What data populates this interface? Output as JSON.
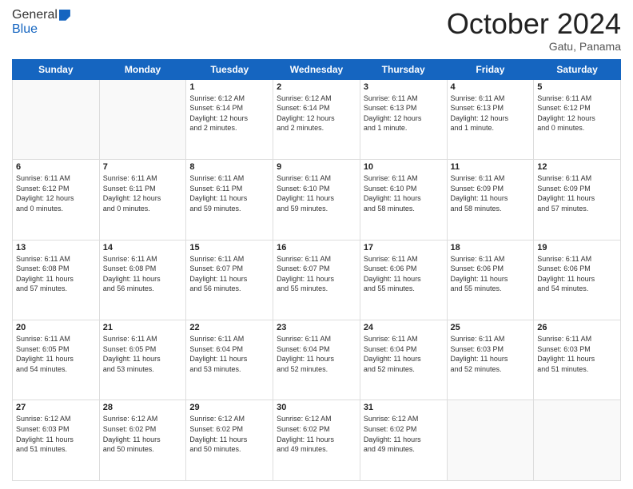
{
  "header": {
    "logo_general": "General",
    "logo_blue": "Blue",
    "month_title": "October 2024",
    "location": "Gatu, Panama"
  },
  "days_of_week": [
    "Sunday",
    "Monday",
    "Tuesday",
    "Wednesday",
    "Thursday",
    "Friday",
    "Saturday"
  ],
  "weeks": [
    [
      {
        "day": "",
        "text": ""
      },
      {
        "day": "",
        "text": ""
      },
      {
        "day": "1",
        "text": "Sunrise: 6:12 AM\nSunset: 6:14 PM\nDaylight: 12 hours\nand 2 minutes."
      },
      {
        "day": "2",
        "text": "Sunrise: 6:12 AM\nSunset: 6:14 PM\nDaylight: 12 hours\nand 2 minutes."
      },
      {
        "day": "3",
        "text": "Sunrise: 6:11 AM\nSunset: 6:13 PM\nDaylight: 12 hours\nand 1 minute."
      },
      {
        "day": "4",
        "text": "Sunrise: 6:11 AM\nSunset: 6:13 PM\nDaylight: 12 hours\nand 1 minute."
      },
      {
        "day": "5",
        "text": "Sunrise: 6:11 AM\nSunset: 6:12 PM\nDaylight: 12 hours\nand 0 minutes."
      }
    ],
    [
      {
        "day": "6",
        "text": "Sunrise: 6:11 AM\nSunset: 6:12 PM\nDaylight: 12 hours\nand 0 minutes."
      },
      {
        "day": "7",
        "text": "Sunrise: 6:11 AM\nSunset: 6:11 PM\nDaylight: 12 hours\nand 0 minutes."
      },
      {
        "day": "8",
        "text": "Sunrise: 6:11 AM\nSunset: 6:11 PM\nDaylight: 11 hours\nand 59 minutes."
      },
      {
        "day": "9",
        "text": "Sunrise: 6:11 AM\nSunset: 6:10 PM\nDaylight: 11 hours\nand 59 minutes."
      },
      {
        "day": "10",
        "text": "Sunrise: 6:11 AM\nSunset: 6:10 PM\nDaylight: 11 hours\nand 58 minutes."
      },
      {
        "day": "11",
        "text": "Sunrise: 6:11 AM\nSunset: 6:09 PM\nDaylight: 11 hours\nand 58 minutes."
      },
      {
        "day": "12",
        "text": "Sunrise: 6:11 AM\nSunset: 6:09 PM\nDaylight: 11 hours\nand 57 minutes."
      }
    ],
    [
      {
        "day": "13",
        "text": "Sunrise: 6:11 AM\nSunset: 6:08 PM\nDaylight: 11 hours\nand 57 minutes."
      },
      {
        "day": "14",
        "text": "Sunrise: 6:11 AM\nSunset: 6:08 PM\nDaylight: 11 hours\nand 56 minutes."
      },
      {
        "day": "15",
        "text": "Sunrise: 6:11 AM\nSunset: 6:07 PM\nDaylight: 11 hours\nand 56 minutes."
      },
      {
        "day": "16",
        "text": "Sunrise: 6:11 AM\nSunset: 6:07 PM\nDaylight: 11 hours\nand 55 minutes."
      },
      {
        "day": "17",
        "text": "Sunrise: 6:11 AM\nSunset: 6:06 PM\nDaylight: 11 hours\nand 55 minutes."
      },
      {
        "day": "18",
        "text": "Sunrise: 6:11 AM\nSunset: 6:06 PM\nDaylight: 11 hours\nand 55 minutes."
      },
      {
        "day": "19",
        "text": "Sunrise: 6:11 AM\nSunset: 6:06 PM\nDaylight: 11 hours\nand 54 minutes."
      }
    ],
    [
      {
        "day": "20",
        "text": "Sunrise: 6:11 AM\nSunset: 6:05 PM\nDaylight: 11 hours\nand 54 minutes."
      },
      {
        "day": "21",
        "text": "Sunrise: 6:11 AM\nSunset: 6:05 PM\nDaylight: 11 hours\nand 53 minutes."
      },
      {
        "day": "22",
        "text": "Sunrise: 6:11 AM\nSunset: 6:04 PM\nDaylight: 11 hours\nand 53 minutes."
      },
      {
        "day": "23",
        "text": "Sunrise: 6:11 AM\nSunset: 6:04 PM\nDaylight: 11 hours\nand 52 minutes."
      },
      {
        "day": "24",
        "text": "Sunrise: 6:11 AM\nSunset: 6:04 PM\nDaylight: 11 hours\nand 52 minutes."
      },
      {
        "day": "25",
        "text": "Sunrise: 6:11 AM\nSunset: 6:03 PM\nDaylight: 11 hours\nand 52 minutes."
      },
      {
        "day": "26",
        "text": "Sunrise: 6:11 AM\nSunset: 6:03 PM\nDaylight: 11 hours\nand 51 minutes."
      }
    ],
    [
      {
        "day": "27",
        "text": "Sunrise: 6:12 AM\nSunset: 6:03 PM\nDaylight: 11 hours\nand 51 minutes."
      },
      {
        "day": "28",
        "text": "Sunrise: 6:12 AM\nSunset: 6:02 PM\nDaylight: 11 hours\nand 50 minutes."
      },
      {
        "day": "29",
        "text": "Sunrise: 6:12 AM\nSunset: 6:02 PM\nDaylight: 11 hours\nand 50 minutes."
      },
      {
        "day": "30",
        "text": "Sunrise: 6:12 AM\nSunset: 6:02 PM\nDaylight: 11 hours\nand 49 minutes."
      },
      {
        "day": "31",
        "text": "Sunrise: 6:12 AM\nSunset: 6:02 PM\nDaylight: 11 hours\nand 49 minutes."
      },
      {
        "day": "",
        "text": ""
      },
      {
        "day": "",
        "text": ""
      }
    ]
  ]
}
